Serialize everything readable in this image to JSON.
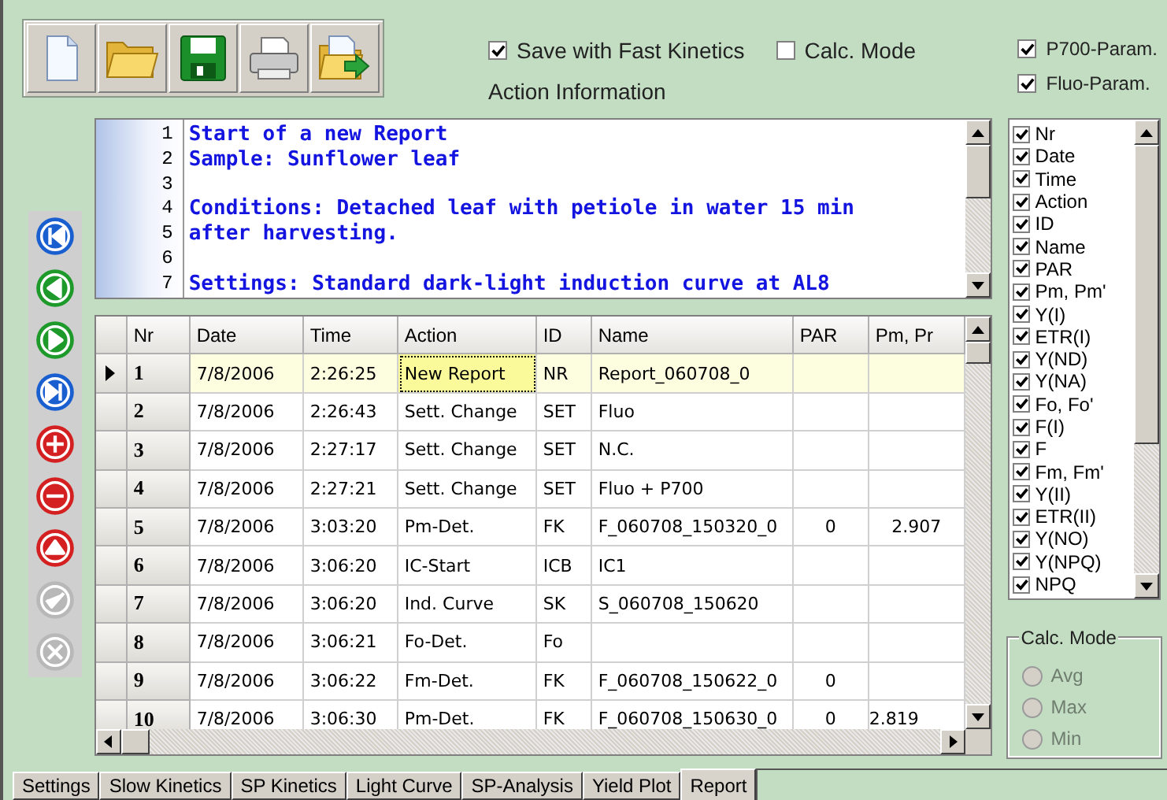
{
  "options": [
    {
      "label": "Save with Fast Kinetics",
      "checked": true
    },
    {
      "label": "Calc. Mode",
      "checked": false
    }
  ],
  "param_options": [
    {
      "label": "P700-Param.",
      "checked": true
    },
    {
      "label": "Fluo-Param.",
      "checked": true
    }
  ],
  "action_information": {
    "label": "Action Information",
    "lines": [
      {
        "number": "1",
        "text": "Start of a new Report"
      },
      {
        "number": "2",
        "text": "Sample: Sunflower leaf"
      },
      {
        "number": "3"
      },
      {
        "number": "4",
        "text": "Conditions: Detached leaf with petiole in water 15 min"
      },
      {
        "number": "5",
        "text": "after harvesting."
      },
      {
        "number": "6"
      },
      {
        "number": "7",
        "text": "Settings: Standard dark-light induction curve at AL8"
      }
    ]
  },
  "nav_buttons": [
    {
      "disabled": false
    },
    {
      "disabled": false
    },
    {
      "disabled": false
    },
    {
      "disabled": false
    },
    {
      "disabled": false
    },
    {
      "disabled": false
    },
    {
      "disabled": false
    },
    {
      "disabled": true
    },
    {
      "disabled": true
    }
  ],
  "table": {
    "columns": [
      "Nr",
      "Date",
      "Time",
      "Action",
      "ID",
      "Name",
      "PAR",
      "Pm, Pr"
    ],
    "rows": [
      {
        "selected": true,
        "cells": [
          "1",
          "7/8/2006",
          "2:26:25",
          "New Report",
          "NR",
          "Report_060708_0",
          "",
          ""
        ]
      },
      {
        "selected": false,
        "cells": [
          "2",
          "7/8/2006",
          "2:26:43",
          "Sett. Change",
          "SET",
          "Fluo",
          "",
          ""
        ]
      },
      {
        "selected": false,
        "cells": [
          "3",
          "7/8/2006",
          "2:27:17",
          "Sett. Change",
          "SET",
          "N.C.",
          "",
          ""
        ]
      },
      {
        "selected": false,
        "cells": [
          "4",
          "7/8/2006",
          "2:27:21",
          "Sett. Change",
          "SET",
          "Fluo + P700",
          "",
          ""
        ]
      },
      {
        "selected": false,
        "cells": [
          "5",
          "7/8/2006",
          "3:03:20",
          "Pm-Det.",
          "FK",
          "F_060708_150320_0",
          "0",
          "2.907"
        ]
      },
      {
        "selected": false,
        "cells": [
          "6",
          "7/8/2006",
          "3:06:20",
          "IC-Start",
          "ICB",
          "IC1",
          "",
          ""
        ]
      },
      {
        "selected": false,
        "cells": [
          "7",
          "7/8/2006",
          "3:06:20",
          "Ind. Curve",
          "SK",
          "S_060708_150620",
          "",
          ""
        ]
      },
      {
        "selected": false,
        "cells": [
          "8",
          "7/8/2006",
          "3:06:21",
          "Fo-Det.",
          "Fo",
          "",
          "",
          ""
        ]
      },
      {
        "selected": false,
        "cells": [
          "9",
          "7/8/2006",
          "3:06:22",
          "Fm-Det.",
          "FK",
          "F_060708_150622_0",
          "0",
          ""
        ]
      },
      {
        "selected": false,
        "cells": [
          "10",
          "7/8/2006",
          "3:06:30",
          "Pm-Det.",
          "FK",
          "F_060708_150630_0",
          "0",
          "2.819"
        ]
      }
    ]
  },
  "column_list": [
    {
      "label": "Nr",
      "checked": true
    },
    {
      "label": "Date",
      "checked": true
    },
    {
      "label": "Time",
      "checked": true
    },
    {
      "label": "Action",
      "checked": true
    },
    {
      "label": "ID",
      "checked": true
    },
    {
      "label": "Name",
      "checked": true
    },
    {
      "label": "PAR",
      "checked": true
    },
    {
      "label": "Pm, Pm'",
      "checked": true
    },
    {
      "label": "Y(I)",
      "checked": true
    },
    {
      "label": "ETR(I)",
      "checked": true
    },
    {
      "label": "Y(ND)",
      "checked": true
    },
    {
      "label": "Y(NA)",
      "checked": true
    },
    {
      "label": "Fo, Fo'",
      "checked": true
    },
    {
      "label": "F(I)",
      "checked": true
    },
    {
      "label": "F",
      "checked": true
    },
    {
      "label": "Fm, Fm'",
      "checked": true
    },
    {
      "label": "Y(II)",
      "checked": true
    },
    {
      "label": "ETR(II)",
      "checked": true
    },
    {
      "label": "Y(NO)",
      "checked": true
    },
    {
      "label": "Y(NPQ)",
      "checked": true
    },
    {
      "label": "NPQ",
      "checked": true
    }
  ],
  "calc_mode": {
    "title": "Calc. Mode",
    "options": [
      {
        "label": "Avg",
        "selected": false,
        "disabled": true
      },
      {
        "label": "Max",
        "selected": false,
        "disabled": true
      },
      {
        "label": "Min",
        "selected": false,
        "disabled": true
      }
    ]
  },
  "tabs": [
    {
      "label": "Settings",
      "selected": false
    },
    {
      "label": "Slow Kinetics",
      "selected": false
    },
    {
      "label": "SP Kinetics",
      "selected": false
    },
    {
      "label": "Light Curve",
      "selected": false
    },
    {
      "label": "SP-Analysis",
      "selected": false
    },
    {
      "label": "Yield Plot",
      "selected": false
    },
    {
      "label": "Report",
      "selected": true
    }
  ]
}
